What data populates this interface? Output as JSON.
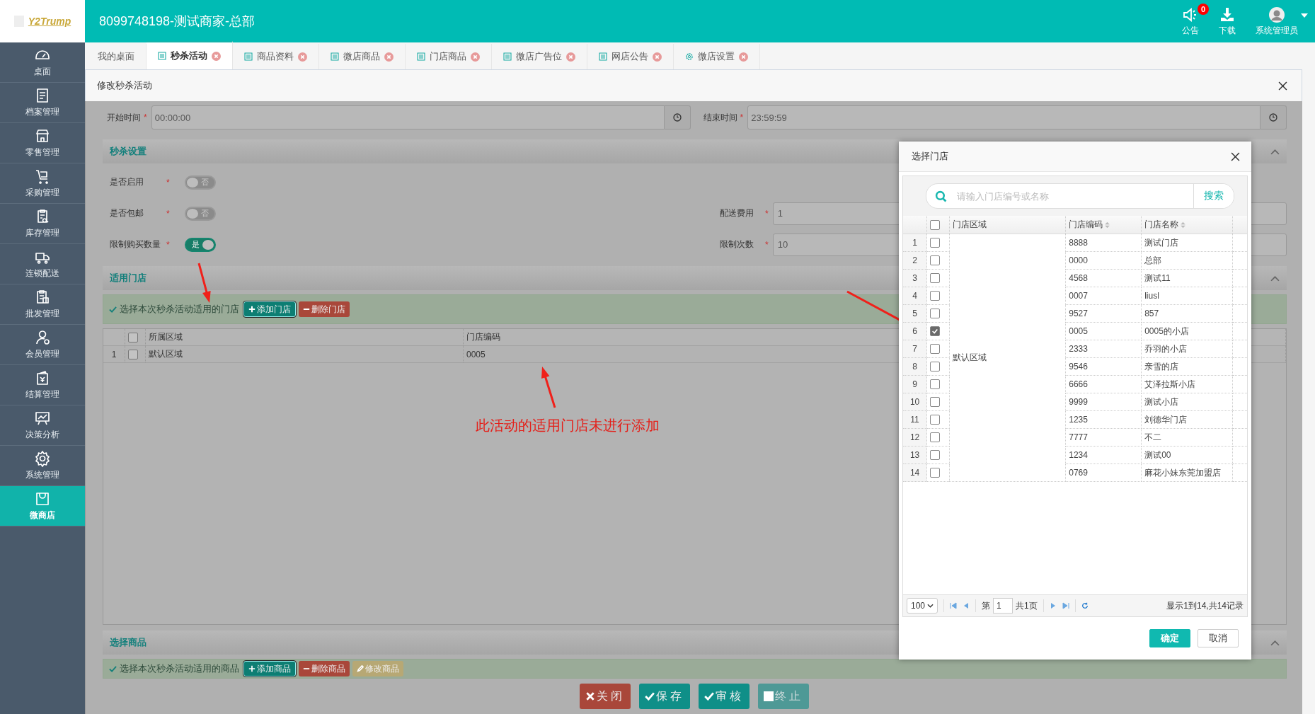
{
  "header": {
    "logo": "Y2Trump",
    "title": "8099748198-测试商家-总部",
    "actions": [
      {
        "kind": "notice",
        "label": "公告",
        "badge": "0"
      },
      {
        "kind": "download",
        "label": "下载"
      }
    ],
    "user": {
      "name": "系统管理员"
    }
  },
  "sidebar": {
    "items": [
      {
        "label": "桌面",
        "selected": false
      },
      {
        "label": "档案管理",
        "selected": false
      },
      {
        "label": "零售管理",
        "selected": false
      },
      {
        "label": "采购管理",
        "selected": false
      },
      {
        "label": "库存管理",
        "selected": false
      },
      {
        "label": "连锁配送",
        "selected": false
      },
      {
        "label": "批发管理",
        "selected": false
      },
      {
        "label": "会员管理",
        "selected": false
      },
      {
        "label": "结算管理",
        "selected": false
      },
      {
        "label": "决策分析",
        "selected": false
      },
      {
        "label": "系统管理",
        "selected": false
      },
      {
        "label": "微商店",
        "selected": true
      }
    ]
  },
  "tabs": [
    {
      "kind": "plain",
      "label": "我的桌面",
      "selected": false
    },
    {
      "kind": "list",
      "label": "秒杀活动",
      "selected": true
    },
    {
      "kind": "list",
      "label": "商品资料",
      "selected": false
    },
    {
      "kind": "list",
      "label": "微店商品",
      "selected": false
    },
    {
      "kind": "list",
      "label": "门店商品",
      "selected": false
    },
    {
      "kind": "list",
      "label": "微店广告位",
      "selected": false
    },
    {
      "kind": "list",
      "label": "网店公告",
      "selected": false
    },
    {
      "kind": "settings",
      "label": "微店设置",
      "selected": false
    }
  ],
  "panel": {
    "title": "修改秒杀活动"
  },
  "time_fields": [
    {
      "label": "开始时间",
      "required_mark": "*",
      "value": "00:00:00"
    },
    {
      "label": "结束时间",
      "required_mark": "*",
      "value": "23:59:59"
    }
  ],
  "settings_section": {
    "title": "秒杀设置",
    "rows": [
      {
        "label": "是否启用",
        "required_mark": "*",
        "on": false,
        "state_text": "否"
      },
      {
        "label": "是否包邮",
        "required_mark": "*",
        "on": false,
        "state_text": "否",
        "field": {
          "label": "配送费用",
          "required_mark": "*",
          "value": "1"
        }
      },
      {
        "label": "限制购买数量",
        "required_mark": "*",
        "on": true,
        "state_text": "是",
        "field": {
          "label": "限制次数",
          "required_mark": "*",
          "value": "10"
        }
      }
    ]
  },
  "stores_section": {
    "title": "适用门店",
    "hint": "选择本次秒杀活动适用的门店",
    "buttons": [
      {
        "kind": "add",
        "label": "添加门店"
      },
      {
        "kind": "delete",
        "label": "删除门店"
      }
    ],
    "all_checked": false,
    "columns": [
      "所属区域",
      "门店编码"
    ],
    "rows": [
      {
        "index": "1",
        "checked": false,
        "cells": [
          "默认区域",
          "0005"
        ]
      }
    ]
  },
  "goods_section": {
    "title": "选择商品",
    "hint": "选择本次秒杀活动适用的商品",
    "buttons": [
      {
        "kind": "add",
        "label": "添加商品"
      },
      {
        "kind": "delete",
        "label": "删除商品"
      },
      {
        "kind": "edit",
        "label": "修改商品"
      }
    ]
  },
  "footer_buttons": [
    {
      "kind": "close",
      "label": "关闭",
      "disabled": false
    },
    {
      "kind": "save",
      "label": "保存",
      "disabled": false
    },
    {
      "kind": "approve",
      "label": "审核",
      "disabled": false
    },
    {
      "kind": "stop",
      "label": "终止",
      "disabled": true
    }
  ],
  "annotation": {
    "text": "此活动的适用门店未进行添加"
  },
  "dialog": {
    "title": "选择门店",
    "search": {
      "placeholder": "请输入门店编号或名称",
      "button": "搜索"
    },
    "all_checked": false,
    "columns": [
      {
        "label": "门店区域",
        "sortable": false
      },
      {
        "label": "门店编码",
        "sortable": true
      },
      {
        "label": "门店名称",
        "sortable": true
      }
    ],
    "region": "默认区域",
    "rows": [
      {
        "index": "1",
        "checked": false,
        "code": "8888",
        "name": "测试门店"
      },
      {
        "index": "2",
        "checked": false,
        "code": "0000",
        "name": "总部"
      },
      {
        "index": "3",
        "checked": false,
        "code": "4568",
        "name": "测试11"
      },
      {
        "index": "4",
        "checked": false,
        "code": "0007",
        "name": "liusl"
      },
      {
        "index": "5",
        "checked": false,
        "code": "9527",
        "name": "857"
      },
      {
        "index": "6",
        "checked": true,
        "code": "0005",
        "name": "0005的小店"
      },
      {
        "index": "7",
        "checked": false,
        "code": "2333",
        "name": "乔羽的小店"
      },
      {
        "index": "8",
        "checked": false,
        "code": "9546",
        "name": "亲雪的店"
      },
      {
        "index": "9",
        "checked": false,
        "code": "6666",
        "name": "艾泽拉斯小店"
      },
      {
        "index": "10",
        "checked": false,
        "code": "9999",
        "name": "测试小店"
      },
      {
        "index": "11",
        "checked": false,
        "code": "1235",
        "name": "刘德华门店"
      },
      {
        "index": "12",
        "checked": false,
        "code": "7777",
        "name": "不二"
      },
      {
        "index": "13",
        "checked": false,
        "code": "1234",
        "name": "测试00"
      },
      {
        "index": "14",
        "checked": false,
        "code": "0769",
        "name": "麻花小妹东莞加盟店"
      }
    ],
    "pager": {
      "page_size": "100",
      "page_prefix": "第",
      "page": "1",
      "page_total": "共1页",
      "summary": "显示1到14,共14记录"
    },
    "buttons": [
      {
        "kind": "confirm",
        "label": "确定"
      },
      {
        "kind": "cancel",
        "label": "取消"
      }
    ]
  }
}
